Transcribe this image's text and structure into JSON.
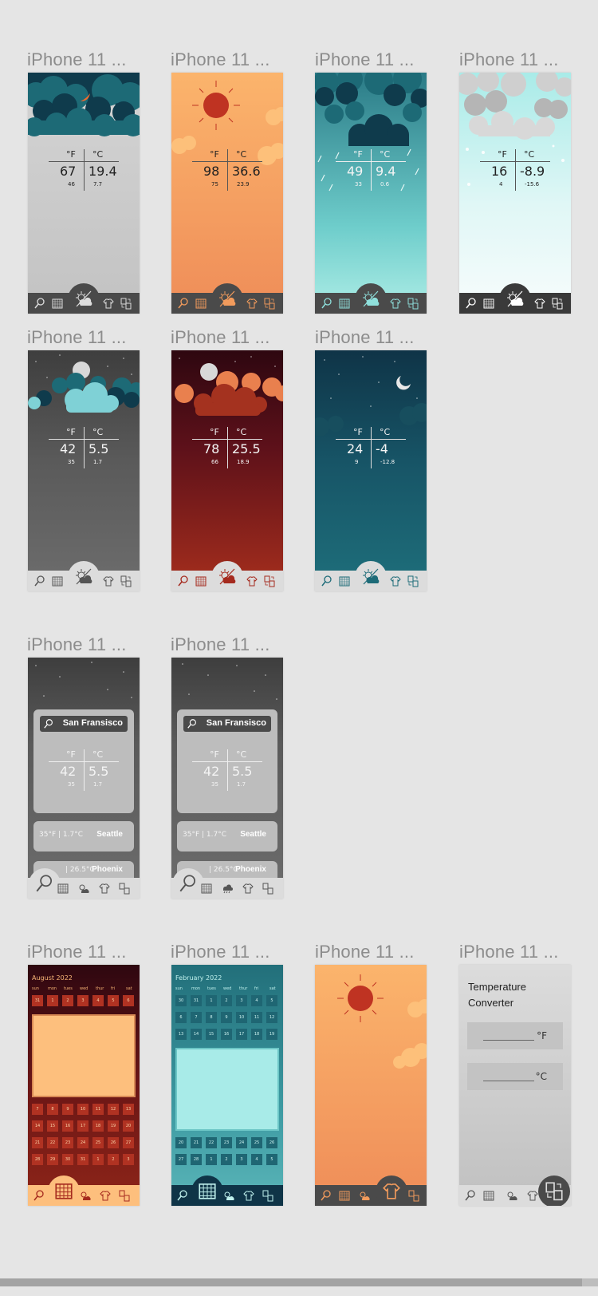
{
  "frame_label": "iPhone 11 ...",
  "colors": {
    "canvas": "#e5e5e5",
    "label": "#8c8c8c",
    "nav_dark": "#4a4a4a",
    "nav_light": "#dcdcdc"
  },
  "units": {
    "f": "°F",
    "c": "°C"
  },
  "weather_screens": [
    {
      "f": "67",
      "c": "19.4",
      "f_low": "46",
      "c_low": "7.7"
    },
    {
      "f": "98",
      "c": "36.6",
      "f_low": "75",
      "c_low": "23.9"
    },
    {
      "f": "49",
      "c": "9.4",
      "f_low": "33",
      "c_low": "0.6"
    },
    {
      "f": "16",
      "c": "-8.9",
      "f_low": "4",
      "c_low": "-15.6"
    },
    {
      "f": "42",
      "c": "5.5",
      "f_low": "35",
      "c_low": "1.7"
    },
    {
      "f": "78",
      "c": "25.5",
      "f_low": "66",
      "c_low": "18.9"
    },
    {
      "f": "24",
      "c": "-4",
      "f_low": "9",
      "c_low": "-12.8"
    }
  ],
  "search_screens": [
    {
      "city": "San Fransisco",
      "f": "42",
      "c": "5.5",
      "f_low": "35",
      "c_low": "1.7",
      "rows": [
        {
          "temp": "35°F | 1.7°C",
          "city": "Seattle"
        },
        {
          "temp": "| 26.5°C",
          "city": "Phoenix"
        }
      ]
    },
    {
      "city": "San Fransisco",
      "f": "42",
      "c": "5.5",
      "f_low": "35",
      "c_low": "1.7",
      "rows": [
        {
          "temp": "35°F | 1.7°C",
          "city": "Seattle"
        },
        {
          "temp": "| 26.5°C",
          "city": "Phoenix"
        }
      ]
    }
  ],
  "calendar_aug": {
    "title": "August 2022",
    "days": [
      "sun",
      "mon",
      "tues",
      "wed",
      "thur",
      "fri",
      "sat"
    ],
    "weeks_top": [
      [
        "31",
        "1",
        "2",
        "3",
        "4",
        "5",
        "6"
      ]
    ],
    "weeks_bottom": [
      [
        "7",
        "8",
        "9",
        "10",
        "11",
        "12",
        "13"
      ],
      [
        "14",
        "15",
        "16",
        "17",
        "18",
        "19",
        "20"
      ],
      [
        "21",
        "22",
        "23",
        "24",
        "25",
        "26",
        "27"
      ],
      [
        "28",
        "29",
        "30",
        "31",
        "1",
        "2",
        "3"
      ]
    ]
  },
  "calendar_feb": {
    "title": "February 2022",
    "days": [
      "sun",
      "mon",
      "tues",
      "wed",
      "thur",
      "fri",
      "sat"
    ],
    "weeks_top": [
      [
        "30",
        "31",
        "1",
        "2",
        "3",
        "4",
        "5"
      ],
      [
        "6",
        "7",
        "8",
        "9",
        "10",
        "11",
        "12"
      ],
      [
        "13",
        "14",
        "15",
        "16",
        "17",
        "18",
        "19"
      ]
    ],
    "weeks_bottom": [
      [
        "20",
        "21",
        "22",
        "23",
        "24",
        "25",
        "26"
      ],
      [
        "27",
        "28",
        "1",
        "2",
        "3",
        "4",
        "5"
      ]
    ]
  },
  "converter": {
    "title": "Temperature Converter",
    "f_unit": "°F",
    "c_unit": "°C"
  }
}
